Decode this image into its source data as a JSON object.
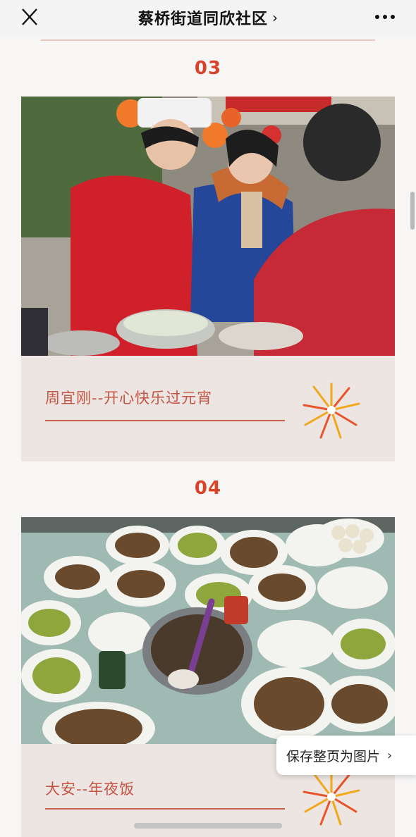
{
  "topbar": {
    "title": "蔡桥街道同欣社区",
    "title_chevron": "›"
  },
  "sections": [
    {
      "number": "03",
      "caption": "周宜刚--开心快乐过元宵",
      "photo_alt": "Volunteers in red chef uniform and blue vest making dumplings together outdoors"
    },
    {
      "number": "04",
      "caption": "大安--年夜饭",
      "photo_alt": "Table covered with many plates of home-cooked dishes for New Year's Eve dinner"
    }
  ],
  "save_button": {
    "label": "保存整页为图片",
    "chevron": "›"
  },
  "colors": {
    "accent": "#d8432a",
    "caption": "#c45545",
    "card_bg": "#ece5e2",
    "page_bg": "#f7f6f5"
  }
}
